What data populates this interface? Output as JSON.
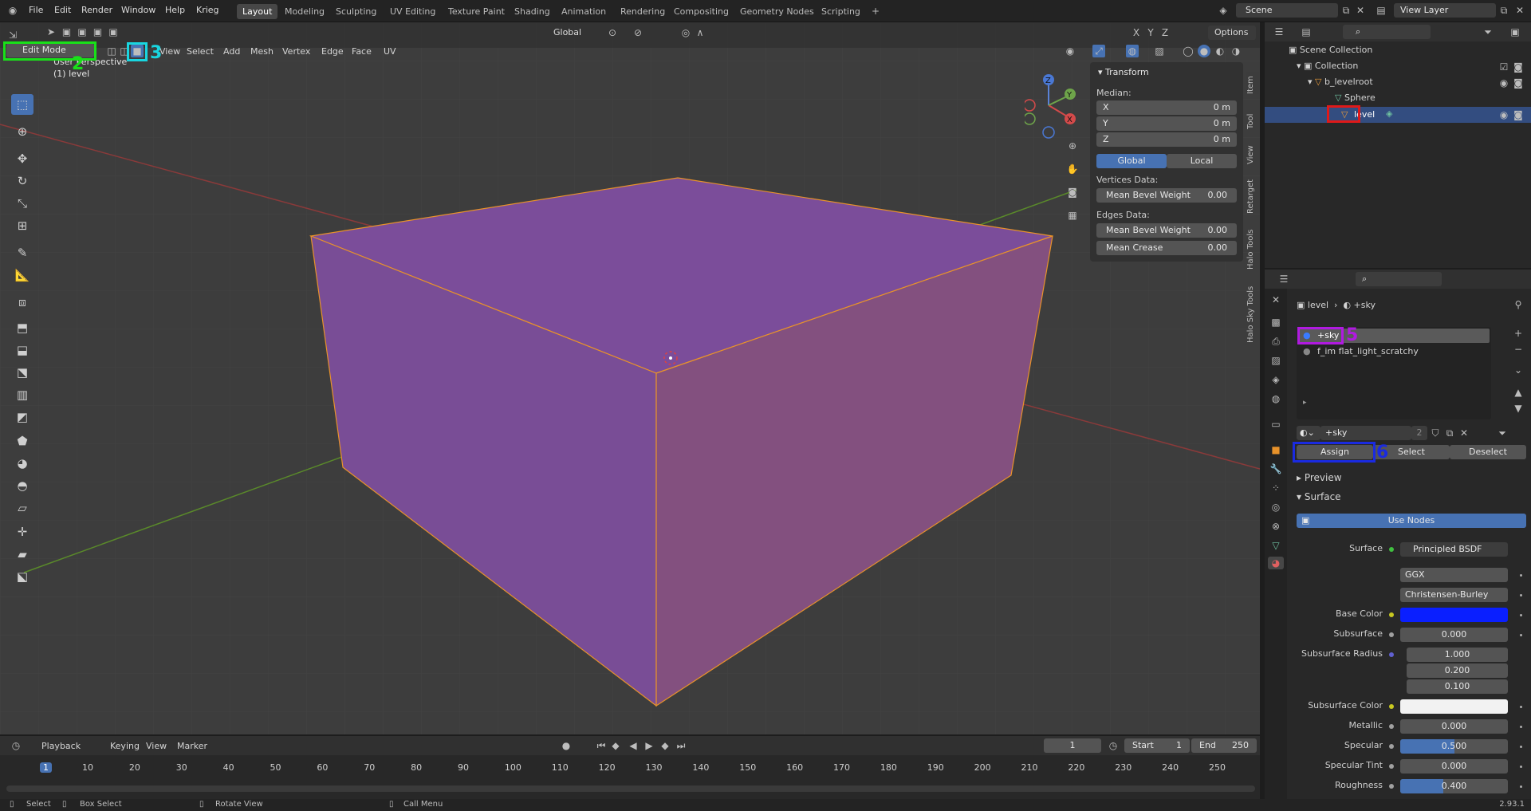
{
  "topbar": {
    "menus": [
      "File",
      "Edit",
      "Render",
      "Window",
      "Help",
      "Krieg"
    ],
    "workspaces": [
      "Layout",
      "Modeling",
      "Sculpting",
      "UV Editing",
      "Texture Paint",
      "Shading",
      "Animation",
      "Rendering",
      "Compositing",
      "Geometry Nodes",
      "Scripting"
    ],
    "active_workspace": "Layout",
    "scene": "Scene",
    "view_layer": "View Layer"
  },
  "viewport": {
    "mode": "Edit Mode",
    "menus": [
      "View",
      "Select",
      "Add",
      "Mesh",
      "Vertex",
      "Edge",
      "Face",
      "UV"
    ],
    "orientation": "Global",
    "options_label": "Options",
    "overlay_title": "User Perspective",
    "overlay_object": "(1) level",
    "gizmo_axes": [
      "Z",
      "Y",
      "X"
    ]
  },
  "npanel": {
    "title": "Transform",
    "median_label": "Median:",
    "x_label": "X",
    "x_val": "0 m",
    "y_label": "Y",
    "y_val": "0 m",
    "z_label": "Z",
    "z_val": "0 m",
    "global_btn": "Global",
    "local_btn": "Local",
    "vertices_label": "Vertices Data:",
    "mean_bevel_label": "Mean Bevel Weight",
    "mean_bevel_val": "0.00",
    "edges_label": "Edges Data:",
    "edge_bevel_label": "Mean Bevel Weight",
    "edge_bevel_val": "0.00",
    "crease_label": "Mean Crease",
    "crease_val": "0.00",
    "tabs": [
      "Item",
      "Tool",
      "View",
      "Retarget",
      "Halo Tools",
      "Halo Sky Tools"
    ]
  },
  "outliner": {
    "root": "Scene Collection",
    "collection": "Collection",
    "items": [
      "b_levelroot",
      "Sphere",
      "level"
    ]
  },
  "properties": {
    "breadcrumb_object": "level",
    "breadcrumb_material": "+sky",
    "slots": [
      "+sky",
      "f_im flat_light_scratchy"
    ],
    "material_name": "+sky",
    "material_users": "2",
    "assign": "Assign",
    "select": "Select",
    "deselect": "Deselect",
    "preview": "Preview",
    "surface_section": "Surface",
    "use_nodes": "Use Nodes",
    "surface_label": "Surface",
    "surface_value": "Principled BSDF",
    "distribution": "GGX",
    "subsurface_method": "Christensen-Burley",
    "base_color_label": "Base Color",
    "base_color": "#0a1fff",
    "subsurface_label": "Subsurface",
    "subsurface_val": "0.000",
    "subsurface_radius_label": "Subsurface Radius",
    "sr1": "1.000",
    "sr2": "0.200",
    "sr3": "0.100",
    "subsurface_color_label": "Subsurface Color",
    "subsurface_color": "#f2f2f2",
    "metallic_label": "Metallic",
    "metallic_val": "0.000",
    "specular_label": "Specular",
    "specular_val": "0.500",
    "specular_fill": 0.5,
    "specular_tint_label": "Specular Tint",
    "specular_tint_val": "0.000",
    "roughness_label": "Roughness",
    "roughness_val": "0.400",
    "roughness_fill": 0.4
  },
  "timeline": {
    "menus": [
      "Playback",
      "Keying",
      "View",
      "Marker"
    ],
    "current_frame": "1",
    "start_label": "Start",
    "start": "1",
    "end_label": "End",
    "end": "250",
    "ticks": [
      "1",
      "10",
      "20",
      "30",
      "40",
      "50",
      "60",
      "70",
      "80",
      "90",
      "100",
      "110",
      "120",
      "130",
      "140",
      "150",
      "160",
      "170",
      "180",
      "190",
      "200",
      "210",
      "220",
      "230",
      "240",
      "250"
    ]
  },
  "statusbar": {
    "select": "Select",
    "box_select": "Box Select",
    "rotate": "Rotate View",
    "call_menu": "Call Menu",
    "version": "2.93.1"
  },
  "annotations": [
    "2",
    "3",
    "5",
    "6"
  ]
}
